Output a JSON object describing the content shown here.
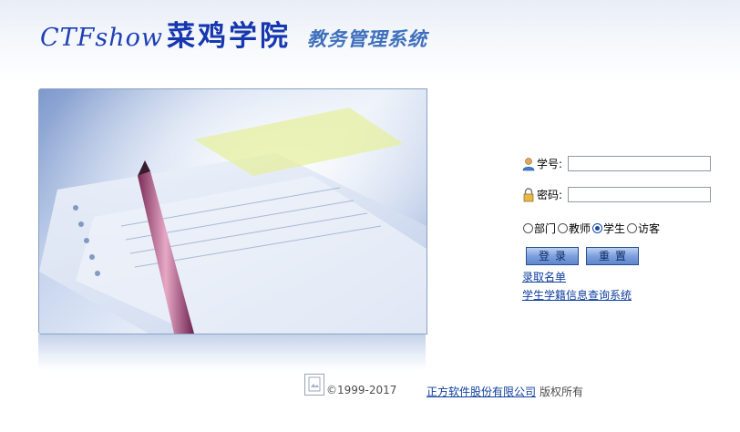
{
  "header": {
    "logo_en": "CTFshow",
    "logo_cn": "菜鸡学院",
    "system_name": "教务管理系统"
  },
  "login": {
    "student_id_label": "学号:",
    "student_id_value": "",
    "password_label": "密码:",
    "password_value": "",
    "roles": [
      {
        "label": "部门",
        "checked": false
      },
      {
        "label": "教师",
        "checked": false
      },
      {
        "label": "学生",
        "checked": true
      },
      {
        "label": "访客",
        "checked": false
      }
    ],
    "login_button": "登录",
    "reset_button": "重置",
    "links": [
      "录取名单",
      "学生学籍信息查询系统"
    ]
  },
  "footer": {
    "copyright": "©1999-2017",
    "company": "正方软件股份有限公司",
    "rights": "版权所有"
  },
  "colors": {
    "brand_blue": "#1637b0",
    "link_blue": "#0f3f9f",
    "button_blue": "#7da0dc"
  }
}
